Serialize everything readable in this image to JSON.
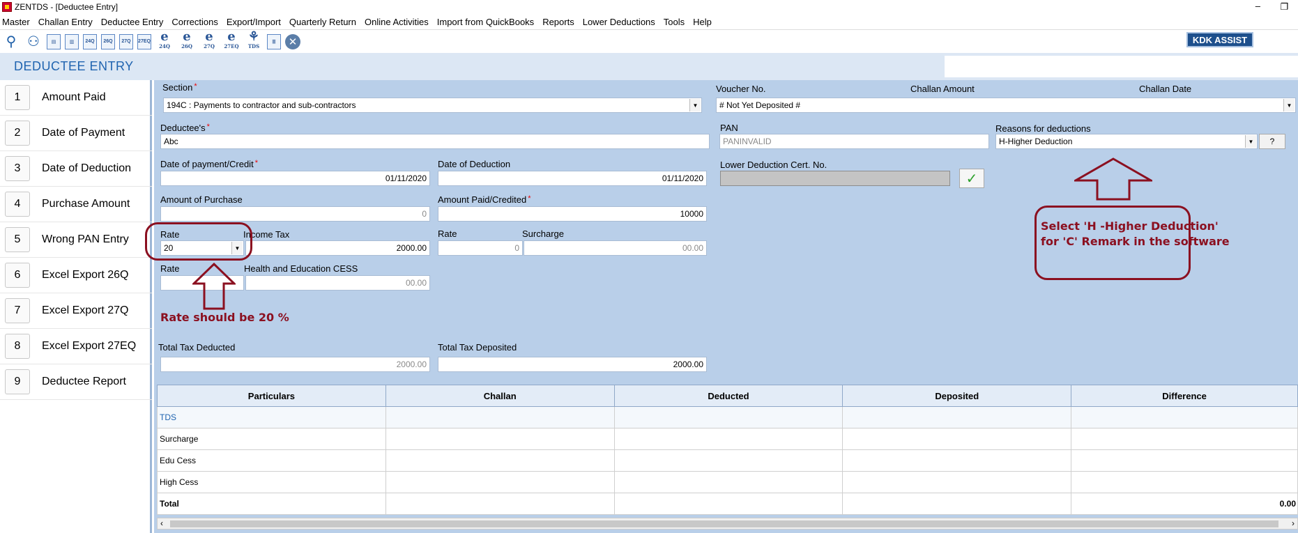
{
  "window": {
    "title": "ZENTDS - [Deductee Entry]"
  },
  "menu": [
    "Master",
    "Challan Entry",
    "Deductee Entry",
    "Corrections",
    "Export/Import",
    "Quarterly Return",
    "Online Activities",
    "Import from QuickBooks",
    "Reports",
    "Lower Deductions",
    "Tools",
    "Help"
  ],
  "toolbar": {
    "kdk_assist": "KDK ASSIST",
    "doc_labels": [
      "24Q",
      "26Q",
      "27Q",
      "27EQ"
    ],
    "e_labels": [
      "24Q",
      "26Q",
      "27Q",
      "27EQ"
    ],
    "tds_label": "TDS"
  },
  "header": {
    "page_title": "DEDUCTEE ENTRY"
  },
  "sidebar": {
    "items": [
      {
        "num": "1",
        "label": "Amount Paid"
      },
      {
        "num": "2",
        "label": "Date of Payment"
      },
      {
        "num": "3",
        "label": "Date of Deduction"
      },
      {
        "num": "4",
        "label": "Purchase Amount"
      },
      {
        "num": "5",
        "label": "Wrong PAN Entry"
      },
      {
        "num": "6",
        "label": "Excel Export 26Q"
      },
      {
        "num": "7",
        "label": "Excel Export 27Q"
      },
      {
        "num": "8",
        "label": "Excel Export 27EQ"
      },
      {
        "num": "9",
        "label": "Deductee Report"
      }
    ]
  },
  "form": {
    "section_label": "Section",
    "section_value": "194C : Payments to contractor and sub-contractors",
    "voucher_label": "Voucher No.",
    "challan_amount_label": "Challan Amount",
    "challan_date_label": "Challan Date",
    "voucher_value": "# Not Yet Deposited #",
    "deductee_label": "Deductee's",
    "deductee_value": "Abc",
    "pan_label": "PAN",
    "pan_value": "PANINVALID",
    "reasons_label": "Reasons for deductions",
    "reasons_value": "H-Higher Deduction",
    "help_button": "?",
    "date_payment_label": "Date of payment/Credit",
    "date_payment_value": "01/11/2020",
    "date_deduction_label": "Date of Deduction",
    "date_deduction_value": "01/11/2020",
    "lower_cert_label": "Lower Deduction Cert. No.",
    "lower_cert_value": "",
    "amount_purchase_label": "Amount of Purchase",
    "amount_purchase_value": "0",
    "amount_paid_label": "Amount Paid/Credited",
    "amount_paid_value": "10000",
    "rate_label": "Rate",
    "rate_value": "20",
    "income_tax_label": "Income Tax",
    "income_tax_value": "2000.00",
    "surcharge_rate_label": "Rate",
    "surcharge_rate_value": "0",
    "surcharge_label": "Surcharge",
    "surcharge_value": "00.00",
    "cess_rate_label": "Rate",
    "cess_rate_value": "",
    "cess_label": "Health and Education CESS",
    "cess_value": "00.00",
    "total_deducted_label": "Total Tax Deducted",
    "total_deducted_value": "2000.00",
    "total_deposited_label": "Total Tax Deposited",
    "total_deposited_value": "2000.00"
  },
  "annotations": {
    "rate_note": "Rate should be 20 %",
    "reason_note_line1": "Select 'H -Higher Deduction'",
    "reason_note_line2": "for 'C' Remark in the software"
  },
  "grid": {
    "columns": [
      "Particulars",
      "Challan",
      "Deducted",
      "Deposited",
      "Difference"
    ],
    "rows": [
      {
        "particular": "TDS",
        "challan": "",
        "deducted": "",
        "deposited": "",
        "difference": ""
      },
      {
        "particular": "Surcharge",
        "challan": "",
        "deducted": "",
        "deposited": "",
        "difference": ""
      },
      {
        "particular": "Edu Cess",
        "challan": "",
        "deducted": "",
        "deposited": "",
        "difference": ""
      },
      {
        "particular": "High Cess",
        "challan": "",
        "deducted": "",
        "deposited": "",
        "difference": ""
      },
      {
        "particular": "Total",
        "challan": "",
        "deducted": "",
        "deposited": "",
        "difference": "0.00"
      }
    ]
  },
  "colors": {
    "accent": "#2064b0",
    "panel": "#b9cfe9",
    "annotation": "#8b1020"
  }
}
